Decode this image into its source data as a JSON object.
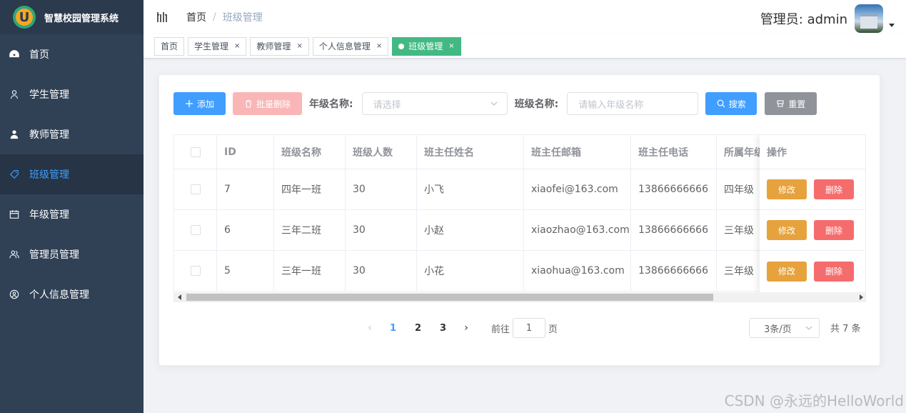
{
  "app": {
    "title": "智慧校园管理系统",
    "logo_letter": "U"
  },
  "sidebar": {
    "items": [
      {
        "label": "首页",
        "icon": "dashboard-icon",
        "active": false
      },
      {
        "label": "学生管理",
        "icon": "user-icon",
        "active": false
      },
      {
        "label": "教师管理",
        "icon": "teacher-icon",
        "active": false
      },
      {
        "label": "班级管理",
        "icon": "tag-icon",
        "active": true
      },
      {
        "label": "年级管理",
        "icon": "calendar-icon",
        "active": false
      },
      {
        "label": "管理员管理",
        "icon": "people-icon",
        "active": false
      },
      {
        "label": "个人信息管理",
        "icon": "profile-icon",
        "active": false
      }
    ]
  },
  "header": {
    "breadcrumb": {
      "home": "首页",
      "separator": "/",
      "current": "班级管理"
    },
    "user": "管理员: admin"
  },
  "tags": [
    {
      "label": "首页",
      "closable": false,
      "active": false
    },
    {
      "label": "学生管理",
      "closable": true,
      "active": false
    },
    {
      "label": "教师管理",
      "closable": true,
      "active": false
    },
    {
      "label": "个人信息管理",
      "closable": true,
      "active": false
    },
    {
      "label": "班级管理",
      "closable": true,
      "active": true
    }
  ],
  "tag_close": "×",
  "toolbar": {
    "add_label": "添加",
    "batch_delete_label": "批量删除",
    "grade_label": "年级名称:",
    "grade_placeholder": "请选择",
    "class_label": "班级名称:",
    "class_placeholder": "请输入年级名称",
    "search_label": "搜索",
    "reset_label": "重置"
  },
  "table": {
    "columns": [
      "ID",
      "班级名称",
      "班级人数",
      "班主任姓名",
      "班主任邮箱",
      "班主任电话",
      "所属年级",
      "操作"
    ],
    "rows": [
      {
        "id": "7",
        "name": "四年一班",
        "count": "30",
        "teacher": "小飞",
        "email": "xiaofei@163.com",
        "phone": "13866666666",
        "grade": "四年级"
      },
      {
        "id": "6",
        "name": "三年二班",
        "count": "30",
        "teacher": "小赵",
        "email": "xiaozhao@163.com",
        "phone": "13866666666",
        "grade": "三年级"
      },
      {
        "id": "5",
        "name": "三年一班",
        "count": "30",
        "teacher": "小花",
        "email": "xiaohua@163.com",
        "phone": "13866666666",
        "grade": "三年级"
      }
    ],
    "edit_label": "修改",
    "delete_label": "删除",
    "scroll_position": 0
  },
  "pagination": {
    "prev": "‹",
    "pages": [
      "1",
      "2",
      "3"
    ],
    "current": "1",
    "next": "›",
    "goto_prefix": "前往",
    "goto_value": "1",
    "goto_suffix": "页",
    "page_size": "3条/页",
    "total": "共 7 条"
  },
  "watermark": "CSDN @永远的HelloWorld",
  "colors": {
    "primary": "#409eff",
    "sidebar": "#304156",
    "tag_active": "#42b983",
    "edit": "#e6a23c",
    "danger": "#f56c6c"
  }
}
